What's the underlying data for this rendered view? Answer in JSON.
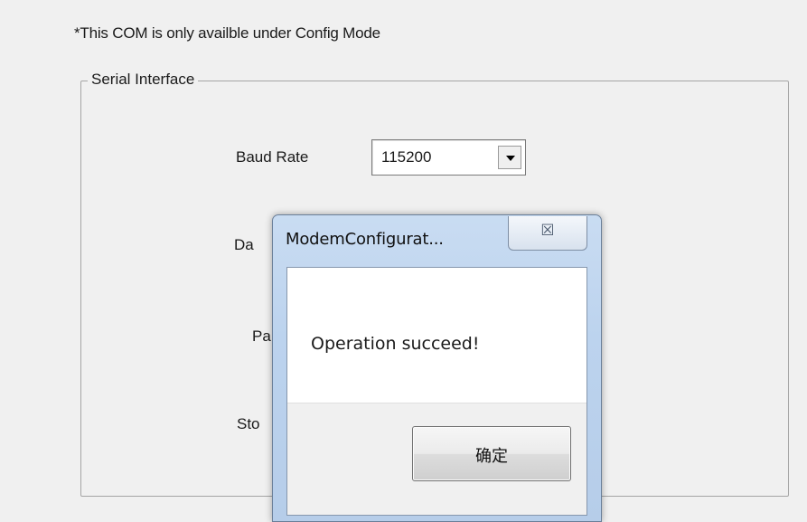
{
  "page": {
    "note": "*This COM is only availble under Config Mode"
  },
  "serial_interface": {
    "legend": "Serial Interface",
    "baud_rate": {
      "label": "Baud Rate",
      "value": "115200"
    },
    "data_bits_label_visible": "Da",
    "parity_label_visible": "Pa",
    "stop_bits_label_visible": "Sto"
  },
  "dialog": {
    "title": "ModemConfigurat...",
    "close_glyph": "☒",
    "message": "Operation succeed!",
    "ok_label": "确定"
  },
  "colors": {
    "window_bg": "#f0f0f0",
    "dialog_frame": "#bcd3ee",
    "groupbox_border": "#a5a5a5"
  },
  "icons": {
    "close": "close-icon",
    "dropdown": "chevron-down-icon"
  }
}
